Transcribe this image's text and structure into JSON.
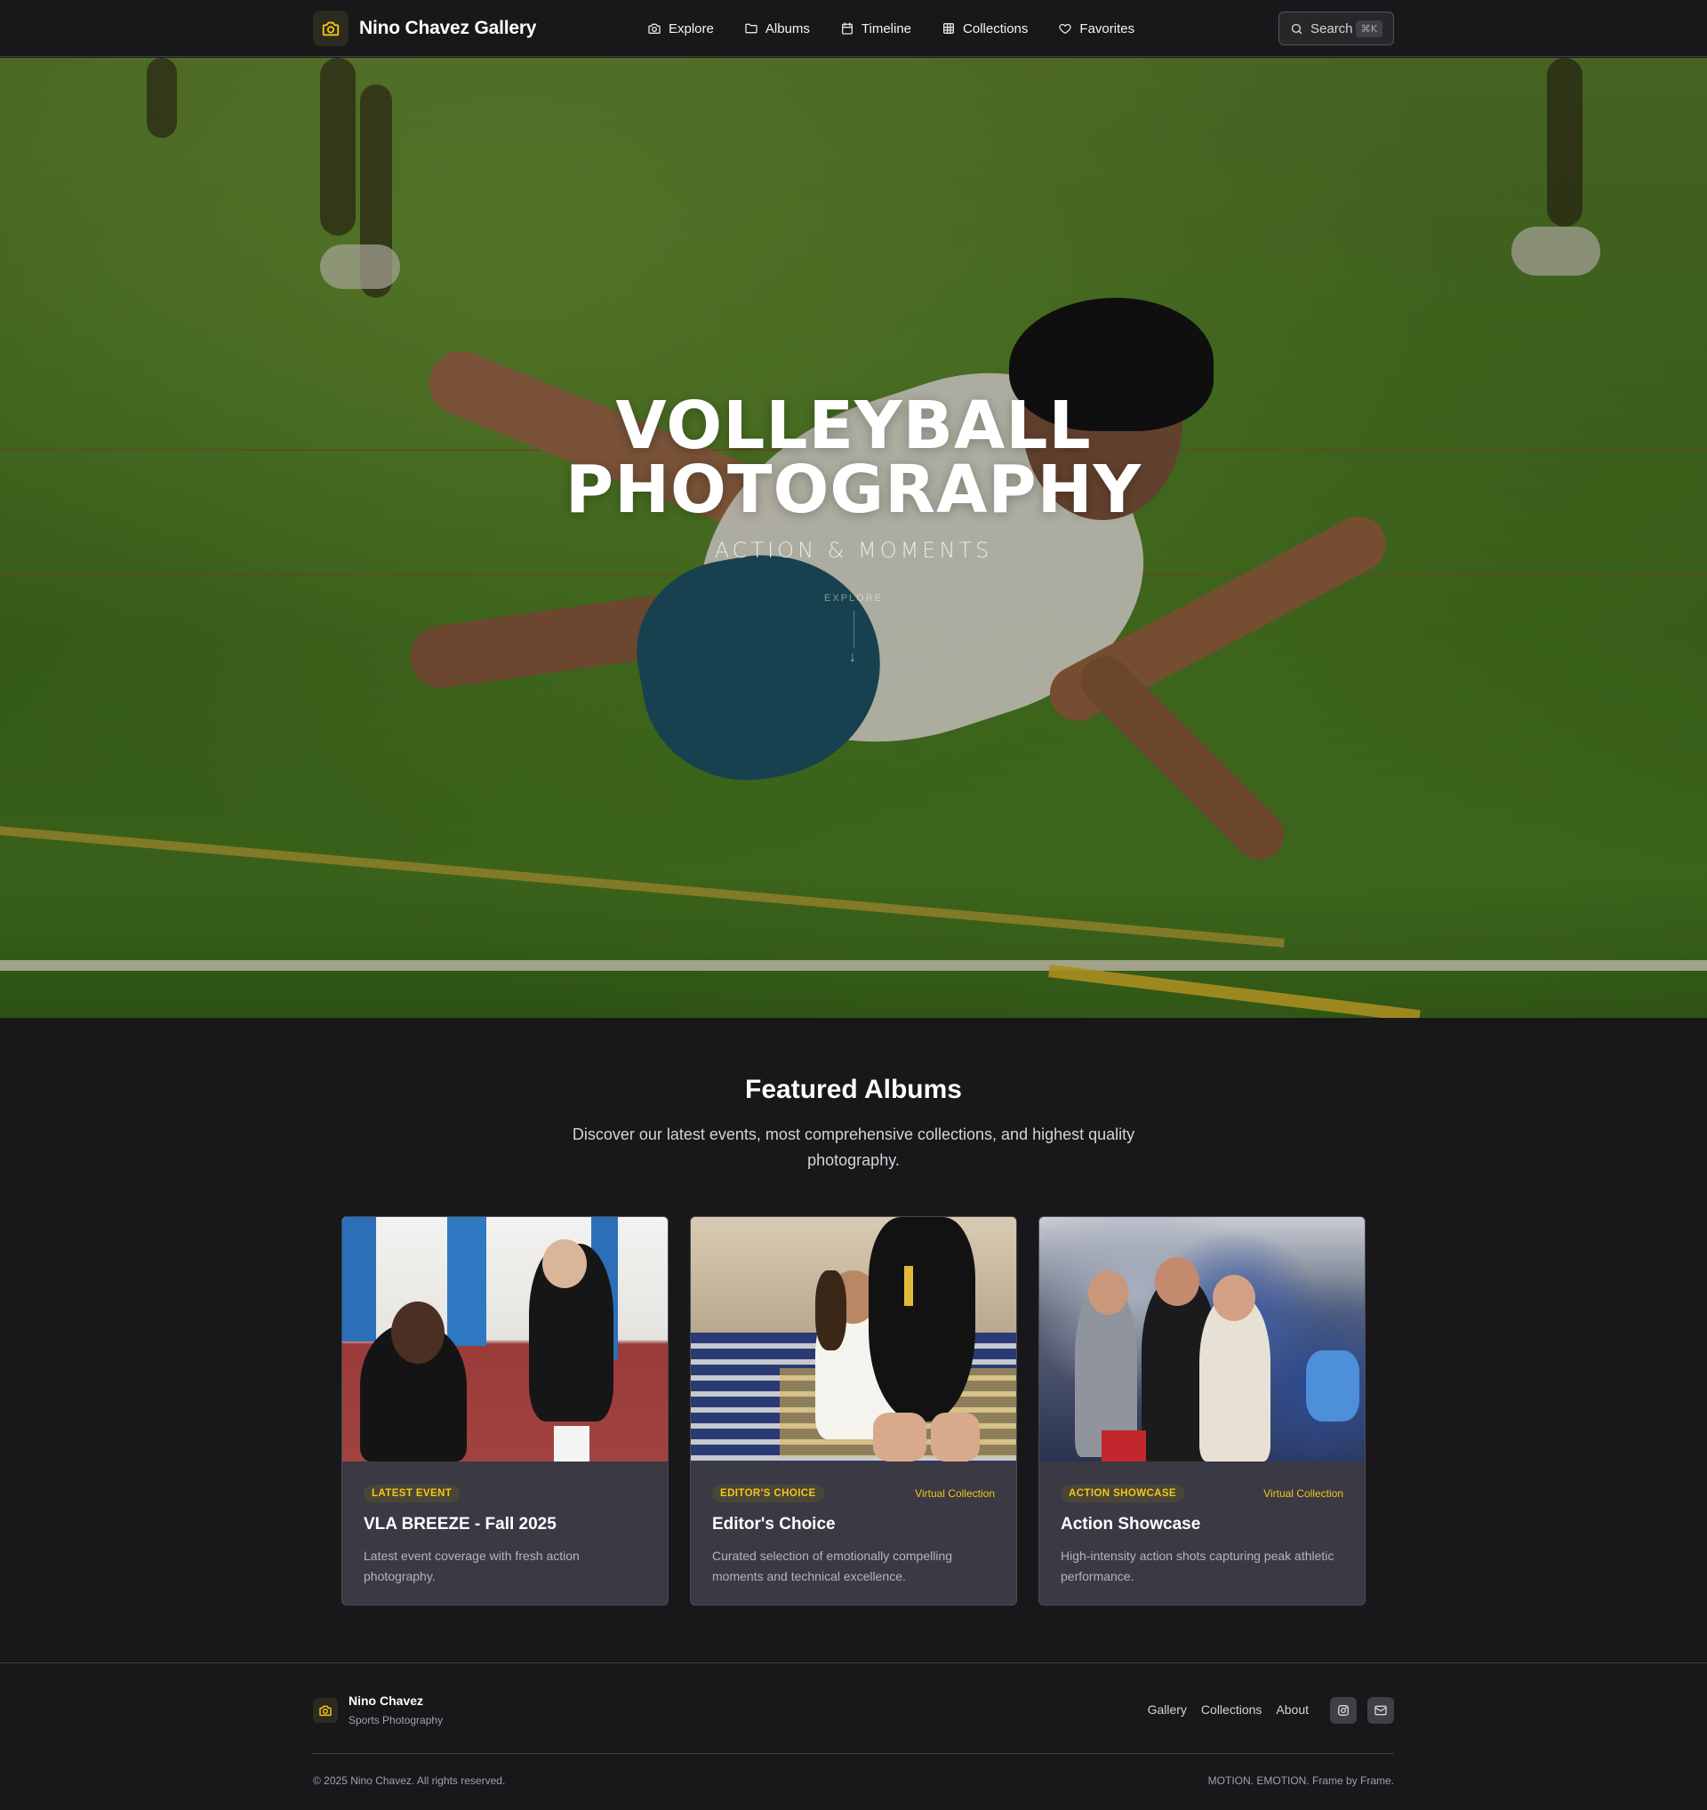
{
  "nav": {
    "brand": "Nino Chavez Gallery",
    "links": [
      {
        "label": "Explore",
        "icon": "camera-icon"
      },
      {
        "label": "Albums",
        "icon": "folder-icon"
      },
      {
        "label": "Timeline",
        "icon": "calendar-icon"
      },
      {
        "label": "Collections",
        "icon": "grid-icon"
      },
      {
        "label": "Favorites",
        "icon": "heart-icon"
      }
    ],
    "search": {
      "label": "Search",
      "shortcut": "⌘K"
    }
  },
  "hero": {
    "title_line1": "VOLLEYBALL",
    "title_line2": "PHOTOGRAPHY",
    "subtitle": "ACTION & MOMENTS",
    "explore": "EXPLORE",
    "arrow": "↓"
  },
  "featured": {
    "title": "Featured Albums",
    "description": "Discover our latest events, most comprehensive collections, and highest quality photography.",
    "cards": [
      {
        "badge": "LATEST EVENT",
        "tag": "",
        "title": "VLA BREEZE - Fall 2025",
        "description": "Latest event coverage with fresh action photography."
      },
      {
        "badge": "EDITOR'S CHOICE",
        "tag": "Virtual Collection",
        "title": "Editor's Choice",
        "description": "Curated selection of emotionally compelling moments and technical excellence."
      },
      {
        "badge": "ACTION SHOWCASE",
        "tag": "Virtual Collection",
        "title": "Action Showcase",
        "description": "High-intensity action shots capturing peak athletic performance."
      }
    ]
  },
  "footer": {
    "name": "Nino Chavez",
    "tagline": "Sports Photography",
    "links": [
      "Gallery",
      "Collections",
      "About"
    ],
    "copyright": "© 2025 Nino Chavez. All rights reserved.",
    "motto": "MOTION. EMOTION. Frame by Frame."
  },
  "colors": {
    "accent": "#f5c518",
    "background": "#18181b",
    "card": "#3a3944"
  }
}
